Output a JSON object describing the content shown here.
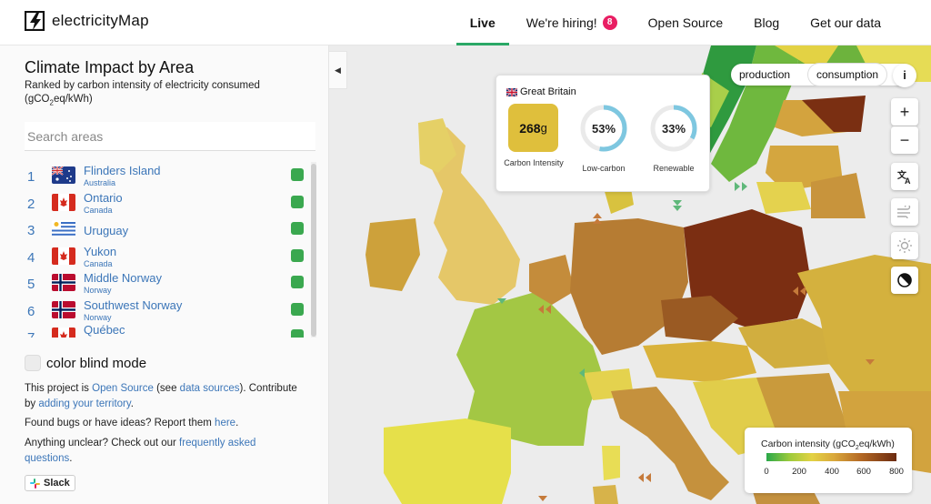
{
  "header": {
    "logo_text": "electricityMap",
    "nav": [
      {
        "label": "Live",
        "active": true
      },
      {
        "label": "We're hiring!",
        "badge": "8"
      },
      {
        "label": "Open Source"
      },
      {
        "label": "Blog"
      },
      {
        "label": "Get our data"
      }
    ]
  },
  "panel": {
    "title": "Climate Impact by Area",
    "subtitle_part1": "Ranked by carbon intensity of electricity consumed (gCO",
    "subtitle_sub": "2",
    "subtitle_part2": "eq/kWh)",
    "search_placeholder": "Search areas",
    "rankings": [
      {
        "rank": "1",
        "name": "Flinders Island",
        "country": "Australia",
        "flag": "au"
      },
      {
        "rank": "2",
        "name": "Ontario",
        "country": "Canada",
        "flag": "ca"
      },
      {
        "rank": "3",
        "name": "Uruguay",
        "country": "",
        "flag": "uy"
      },
      {
        "rank": "4",
        "name": "Yukon",
        "country": "Canada",
        "flag": "ca"
      },
      {
        "rank": "5",
        "name": "Middle Norway",
        "country": "Norway",
        "flag": "no"
      },
      {
        "rank": "6",
        "name": "Southwest Norway",
        "country": "Norway",
        "flag": "no"
      },
      {
        "rank": "7",
        "name": "Québec",
        "country": "",
        "flag": "ca"
      }
    ],
    "swatch_color": "#3aa84f",
    "color_blind_label": "color blind mode",
    "info1_a": "This project is ",
    "info1_link1": "Open Source",
    "info1_b": " (see ",
    "info1_link2": "data sources",
    "info1_c": "). Contribute by ",
    "info1_link3": "adding your territory",
    "info1_d": ".",
    "info2_a": "Found bugs or have ideas? Report them ",
    "info2_link": "here",
    "info2_b": ".",
    "info3_a": "Anything unclear? Check out our ",
    "info3_link": "frequently asked questions",
    "info3_b": ".",
    "slack_label": "Slack"
  },
  "tooltip": {
    "zone": "Great Britain",
    "carbon_value": "268",
    "carbon_unit": "g",
    "carbon_label": "Carbon Intensity",
    "lowcarbon_value": "53%",
    "lowcarbon_fraction": 0.53,
    "lowcarbon_label": "Low-carbon",
    "renewable_value": "33%",
    "renewable_fraction": 0.33,
    "renewable_label": "Renewable"
  },
  "map_controls": {
    "toggle_production": "production",
    "toggle_consumption": "consumption",
    "info": "i",
    "zoom_in": "+",
    "zoom_out": "−"
  },
  "legend": {
    "title_part1": "Carbon intensity (gCO",
    "title_sub": "2",
    "title_part2": "eq/kWh)",
    "ticks": [
      "0",
      "200",
      "400",
      "600",
      "800"
    ]
  }
}
